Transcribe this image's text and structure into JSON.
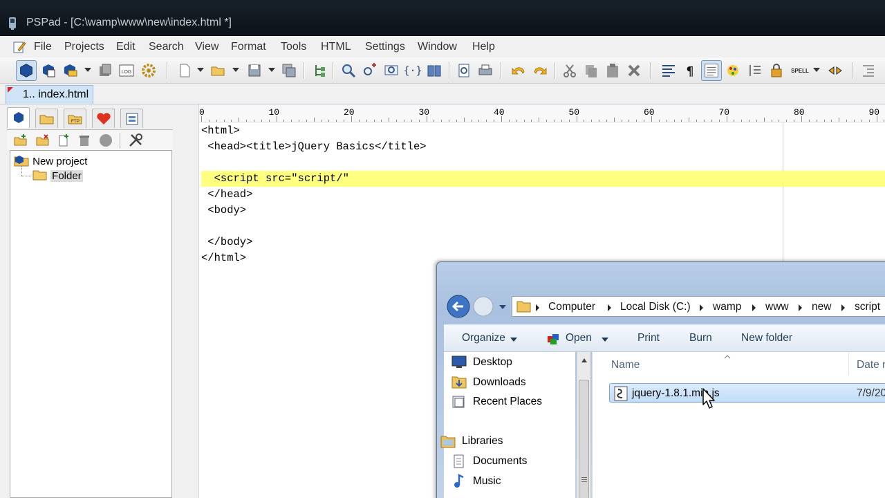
{
  "window": {
    "title": "PSPad - [C:\\wamp\\www\\new\\index.html *]"
  },
  "menu": [
    "File",
    "Projects",
    "Edit",
    "Search",
    "View",
    "Format",
    "Tools",
    "HTML",
    "Settings",
    "Window",
    "Help"
  ],
  "toolbar": {
    "icons": [
      "project-icon",
      "open-project-icon",
      "reopen-project-icon",
      "clipboard-icon",
      "log-icon",
      "settings-icon",
      "new-file-icon",
      "open-file-icon",
      "save-icon",
      "save-all-icon",
      "tree-icon",
      "find-icon",
      "replace-icon",
      "find-in-files-icon",
      "bracket-icon",
      "book-icon",
      "preview-icon",
      "print-icon",
      "undo-icon",
      "redo-icon",
      "cut-icon",
      "copy-icon",
      "paste-icon",
      "delete-icon",
      "wrap-icon",
      "pilcrow-icon",
      "text-view-icon",
      "color-icon",
      "column-icon",
      "lock-icon",
      "spell-icon",
      "bookmark-icon"
    ],
    "spell_label": "SPELL",
    "log_label": "LOG",
    "ftp_label": "FTP"
  },
  "doc_tab": {
    "label": "1.. index.html"
  },
  "project_tree": {
    "root": "New project",
    "child": "Folder"
  },
  "ruler": {
    "labels": [
      "0",
      "10",
      "20",
      "30",
      "40",
      "50",
      "60",
      "70",
      "80",
      "90"
    ]
  },
  "code_lines": [
    "<html>",
    " <head><title>jQuery Basics</title>",
    "",
    "  <script src=\"script/\"",
    " </head>",
    " <body>",
    "",
    " </body>",
    "</html>"
  ],
  "highlighted_line": 3,
  "dialog": {
    "breadcrumb": [
      "Computer",
      "Local Disk (C:)",
      "wamp",
      "www",
      "new",
      "script"
    ],
    "commands": {
      "organize": "Organize",
      "open": "Open",
      "print": "Print",
      "burn": "Burn",
      "new_folder": "New folder"
    },
    "nav_items": [
      "Desktop",
      "Downloads",
      "Recent Places",
      "Libraries",
      "Documents",
      "Music"
    ],
    "columns": {
      "name": "Name",
      "date": "Date m"
    },
    "file": {
      "name": "jquery-1.8.1.min.js",
      "date": "7/9/20"
    }
  }
}
